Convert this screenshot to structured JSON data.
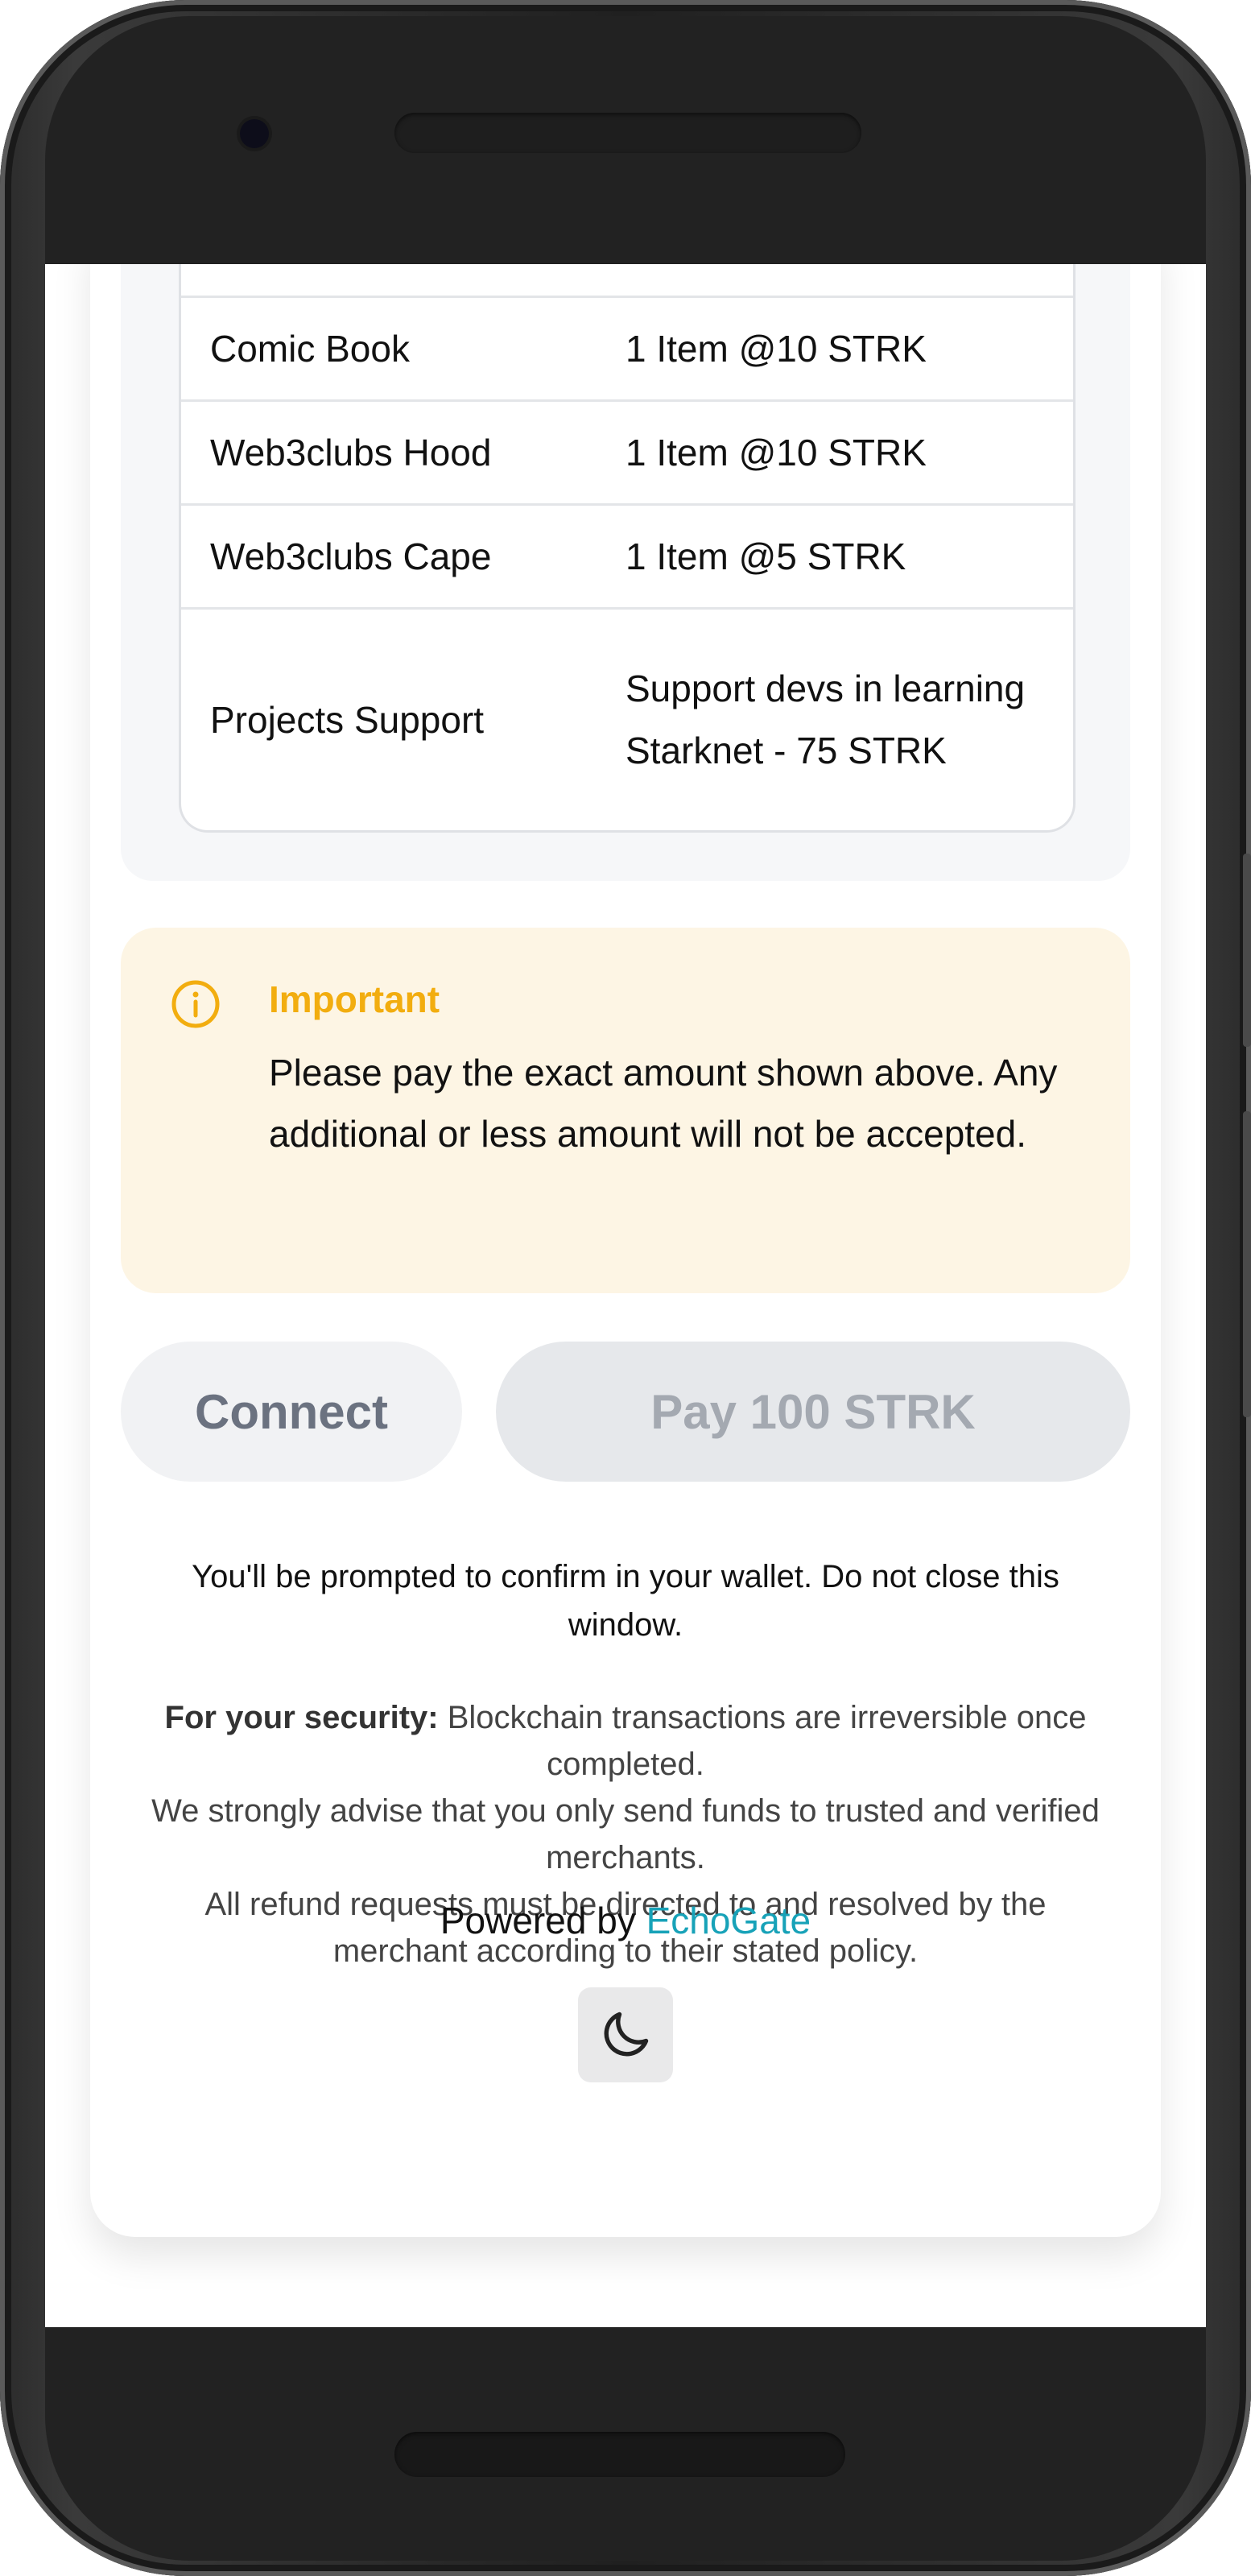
{
  "items": [
    {
      "name": "Comic Book",
      "detail": "1 Item @10 STRK"
    },
    {
      "name": "Web3clubs Hood",
      "detail": "1 Item @10 STRK"
    },
    {
      "name": "Web3clubs Cape",
      "detail": "1 Item @5 STRK"
    },
    {
      "name": "Projects Support",
      "detail": "Support devs in learning Starknet - 75 STRK"
    }
  ],
  "notice": {
    "title": "Important",
    "body": "Please pay the exact amount shown above. Any additional or less amount will not be accepted.",
    "icon": "info-circle-icon",
    "accent_color": "#f2ad0f",
    "background": "#fdf5e4"
  },
  "buttons": {
    "connect_label": "Connect",
    "pay_label": "Pay 100 STRK"
  },
  "prompt_text": "You'll be prompted to confirm in your wallet. Do not close this window.",
  "security": {
    "lead": "For your security:",
    "line1": " Blockchain transactions are irreversible once completed.",
    "line2": "We strongly advise that you only send funds to trusted and verified merchants.",
    "line3": "All refund requests must be directed to and resolved by the merchant according to their stated policy."
  },
  "footer": {
    "powered_by": "Powered by",
    "brand": "EchoGate",
    "brand_color": "#17a2b8",
    "theme_toggle_icon": "moon-icon"
  }
}
